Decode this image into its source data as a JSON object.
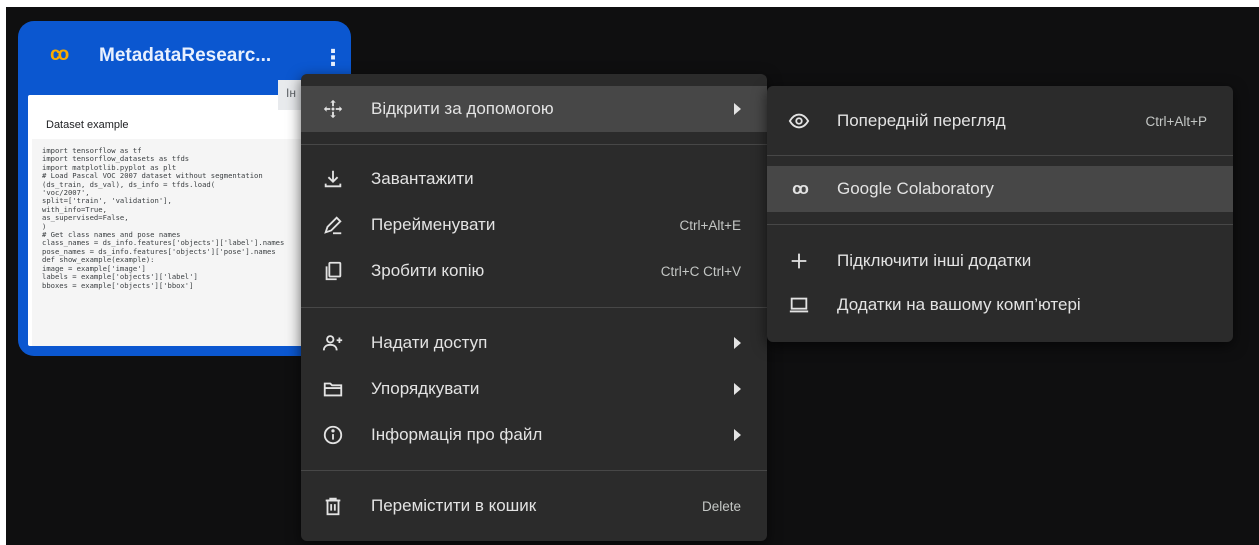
{
  "card": {
    "logo_text": "co",
    "title": "MetadataResearc...",
    "menu_glyph": "⋮",
    "preview_title": "Dataset example",
    "preview_tab_text": "Ін",
    "preview_code": "import tensorflow as tf\nimport tensorflow_datasets as tfds\nimport matplotlib.pyplot as plt\n# Load Pascal VOC 2007 dataset without segmentation\n(ds_train, ds_val), ds_info = tfds.load(\n'voc/2007',\nsplit=['train', 'validation'],\nwith_info=True,\nas_supervised=False,\n)\n# Get class names and pose names\nclass_names = ds_info.features['objects']['label'].names\npose_names = ds_info.features['objects']['pose'].names\ndef show_example(example):\nimage = example['image']\nlabels = example['objects']['label']\nbboxes = example['objects']['bbox']"
  },
  "main_menu": {
    "open_with": "Відкрити за допомогою",
    "download": "Завантажити",
    "rename": "Перейменувати",
    "rename_shortcut": "Ctrl+Alt+E",
    "copy": "Зробити копію",
    "copy_shortcut": "Ctrl+C Ctrl+V",
    "share": "Надати доступ",
    "organize": "Упорядкувати",
    "file_info": "Інформація про файл",
    "trash": "Перемістити в кошик",
    "trash_shortcut": "Delete"
  },
  "sub_menu": {
    "preview": "Попередній перегляд",
    "preview_shortcut": "Ctrl+Alt+P",
    "colab_logo": "co",
    "colab": "Google Colaboratory",
    "connect": "Підключити інші додатки",
    "computer": "Додатки на вашому комп’ютері"
  },
  "colors": {
    "card_blue": "#0b57d0",
    "colab_orange": "#f9ab00",
    "menu_bg": "#2b2b2b",
    "menu_hover": "#474747"
  }
}
